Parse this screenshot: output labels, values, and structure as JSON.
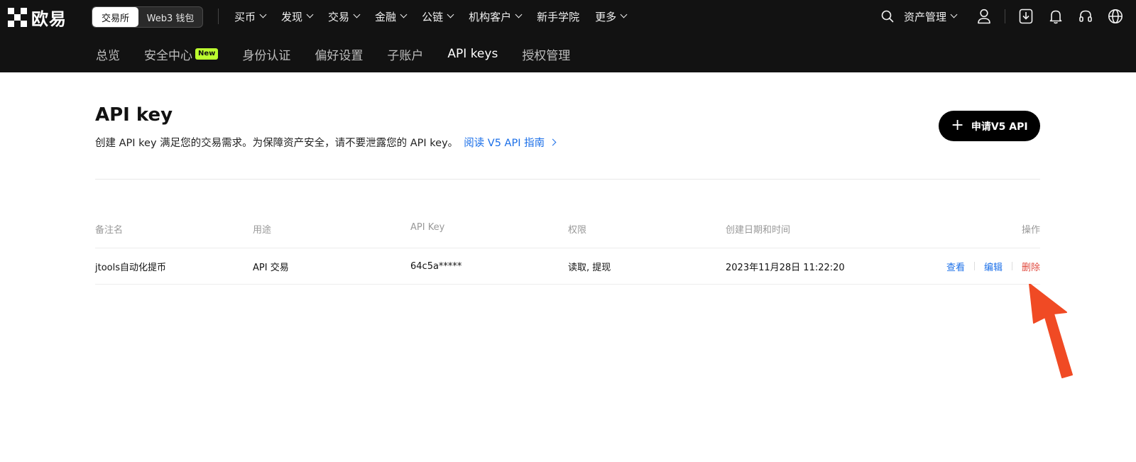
{
  "brand": {
    "name": "欧易"
  },
  "mode_switch": {
    "exchange": "交易所",
    "wallet": "Web3 钱包"
  },
  "main_nav": [
    {
      "label": "买币",
      "dropdown": true
    },
    {
      "label": "发现",
      "dropdown": true
    },
    {
      "label": "交易",
      "dropdown": true
    },
    {
      "label": "金融",
      "dropdown": true
    },
    {
      "label": "公链",
      "dropdown": true
    },
    {
      "label": "机构客户",
      "dropdown": true
    },
    {
      "label": "新手学院",
      "dropdown": false
    },
    {
      "label": "更多",
      "dropdown": true
    }
  ],
  "right_nav": {
    "assets": "资产管理"
  },
  "sub_nav": [
    {
      "label": "总览"
    },
    {
      "label": "安全中心",
      "badge": "New"
    },
    {
      "label": "身份认证"
    },
    {
      "label": "偏好设置"
    },
    {
      "label": "子账户"
    },
    {
      "label": "API keys",
      "active": true
    },
    {
      "label": "授权管理"
    }
  ],
  "page": {
    "title": "API key",
    "description": "创建 API key 满足您的交易需求。为保障资产安全，请不要泄露您的 API key。",
    "guide_link": "阅读 V5 API 指南",
    "apply_button": "申请V5 API"
  },
  "table": {
    "headers": [
      "备注名",
      "用途",
      "API Key",
      "权限",
      "创建日期和时间",
      "操作"
    ],
    "rows": [
      {
        "name": "jtools自动化提币",
        "purpose": "API 交易",
        "key": "64c5a*****",
        "permissions": "读取, 提现",
        "created": "2023年11月28日 11:22:20",
        "actions": {
          "view": "查看",
          "edit": "编辑",
          "delete": "删除"
        }
      }
    ]
  },
  "colors": {
    "link": "#1b6fe8",
    "danger": "#e04a3f",
    "badge": "#bcff2f",
    "nav_bg": "#121212",
    "annotation_arrow": "#f04a24"
  }
}
